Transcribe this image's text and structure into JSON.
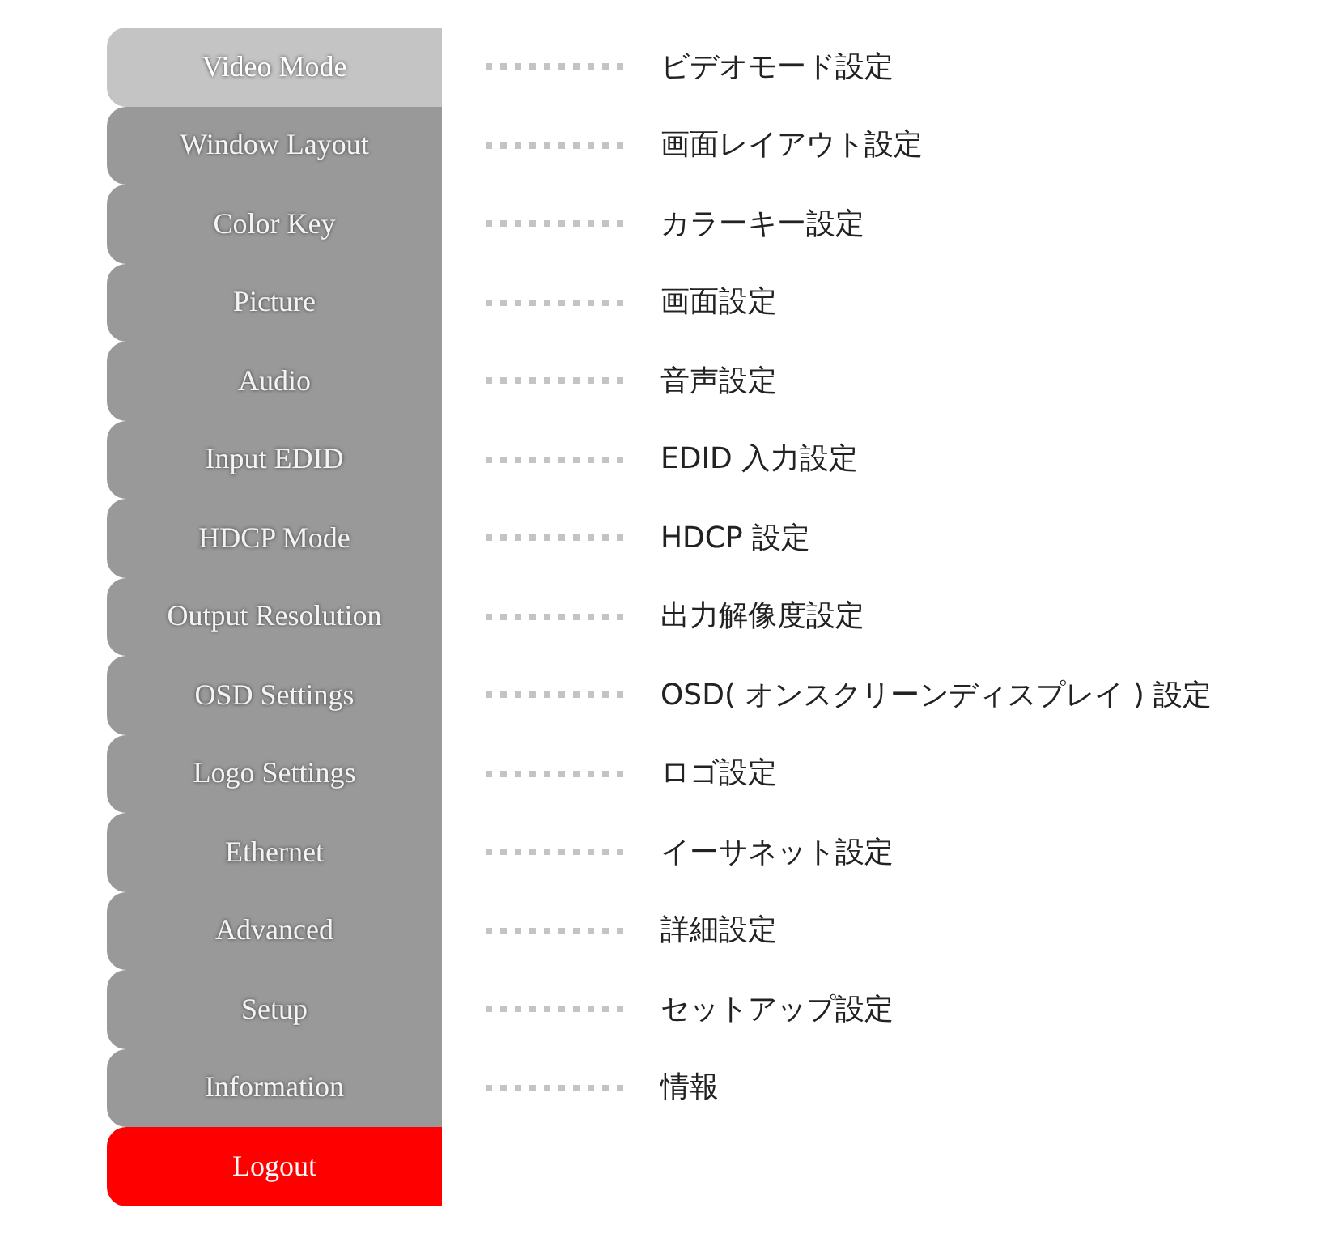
{
  "tabs": [
    {
      "label": "Video Mode",
      "selected": true,
      "note": "ビデオモード設定"
    },
    {
      "label": "Window Layout",
      "selected": false,
      "note": "画面レイアウト設定"
    },
    {
      "label": "Color Key",
      "selected": false,
      "note": "カラーキー設定"
    },
    {
      "label": "Picture",
      "selected": false,
      "note": "画面設定"
    },
    {
      "label": "Audio",
      "selected": false,
      "note": "音声設定"
    },
    {
      "label": "Input EDID",
      "selected": false,
      "note": "EDID 入力設定"
    },
    {
      "label": "HDCP Mode",
      "selected": false,
      "note": "HDCP 設定"
    },
    {
      "label": "Output Resolution",
      "selected": false,
      "note": "出力解像度設定"
    },
    {
      "label": "OSD Settings",
      "selected": false,
      "note": "OSD( オンスクリーンディスプレイ ) 設定"
    },
    {
      "label": "Logo Settings",
      "selected": false,
      "note": "ロゴ設定"
    },
    {
      "label": "Ethernet",
      "selected": false,
      "note": "イーサネット設定"
    },
    {
      "label": "Advanced",
      "selected": false,
      "note": "詳細設定"
    },
    {
      "label": "Setup",
      "selected": false,
      "note": "セットアップ設定"
    },
    {
      "label": "Information",
      "selected": false,
      "note": "情報"
    }
  ],
  "logout": {
    "label": "Logout"
  }
}
